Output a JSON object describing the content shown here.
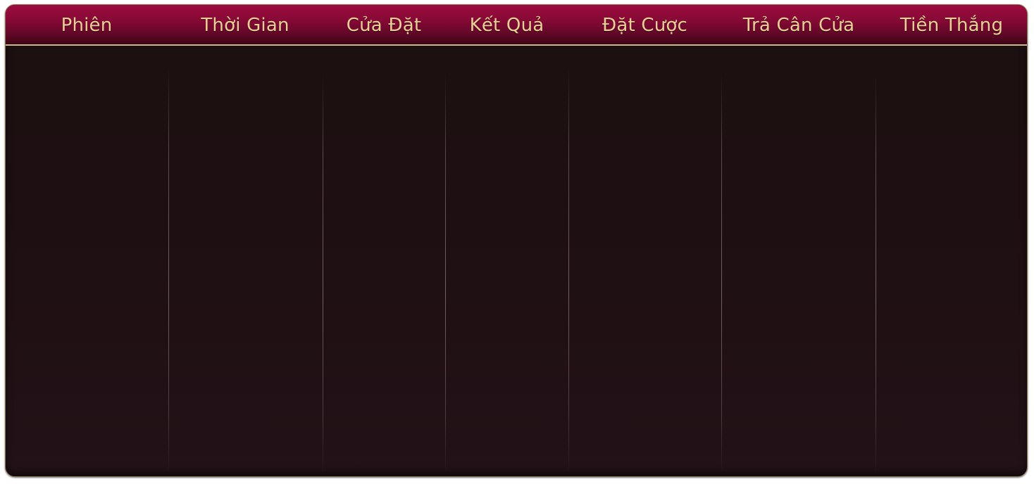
{
  "table": {
    "columns": [
      {
        "label": "Phiên"
      },
      {
        "label": "Thời Gian"
      },
      {
        "label": "Cửa Đặt"
      },
      {
        "label": "Kết Quả"
      },
      {
        "label": "Đặt Cược"
      },
      {
        "label": "Trả Cân Cửa"
      },
      {
        "label": "Tiền Thắng"
      }
    ],
    "rows": []
  },
  "colors": {
    "header_accent": "#9e0c3f",
    "header_text": "#e9cf96",
    "body_background": "#1c1010",
    "border_gold": "#cdb98a"
  }
}
